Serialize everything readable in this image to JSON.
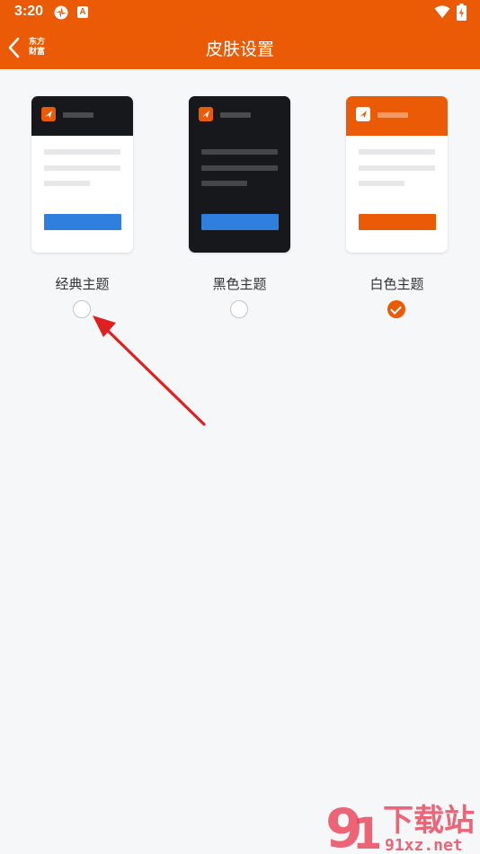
{
  "status_bar": {
    "time": "3:20",
    "notification_icon_letter": "A"
  },
  "header": {
    "back_label": "东方财富",
    "title": "皮肤设置",
    "background_color": "#eb5a05"
  },
  "themes": [
    {
      "label": "经典主题",
      "selected": false
    },
    {
      "label": "黑色主题",
      "selected": false
    },
    {
      "label": "白色主题",
      "selected": true
    }
  ],
  "colors": {
    "accent": "#eb5a05",
    "preview_button_blue": "#2f7fde",
    "dark_theme": "#17181b",
    "annotation_arrow": "#e02020"
  },
  "watermark": {
    "main": "下载站",
    "sub": "91xz.net"
  }
}
